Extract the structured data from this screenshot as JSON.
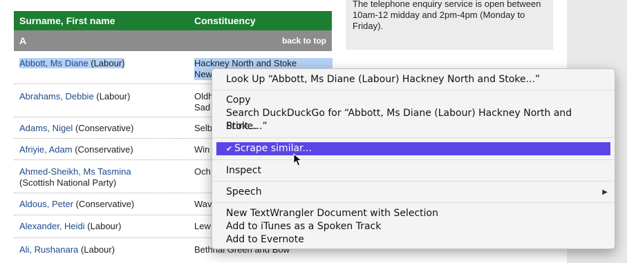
{
  "aside": {
    "enquiry_text": "The telephone enquiry service is open between 10am-12 midday and 2pm-4pm (Monday to Friday)."
  },
  "table": {
    "header": {
      "col_name": "Surname, First name",
      "col_constituency": "Constituency"
    },
    "section_letter": "A",
    "back_to_top": "back to top",
    "rows": [
      {
        "name": "Abbott, Ms Diane",
        "party": "(Labour)",
        "constituency": "Hackney North and Stoke\nNew"
      },
      {
        "name": "Abrahams, Debbie",
        "party": "(Labour)",
        "constituency": "Oldh\nSad"
      },
      {
        "name": "Adams, Nigel",
        "party": "(Conservative)",
        "constituency": "Selb"
      },
      {
        "name": "Afriyie, Adam",
        "party": "(Conservative)",
        "constituency": "Win"
      },
      {
        "name": "Ahmed-Sheikh, Ms Tasmina",
        "party": "(Scottish National Party)",
        "constituency": "Och"
      },
      {
        "name": "Aldous, Peter",
        "party": "(Conservative)",
        "constituency": "Wav"
      },
      {
        "name": "Alexander, Heidi",
        "party": "(Labour)",
        "constituency": "Lew"
      },
      {
        "name": "Ali, Rushanara",
        "party": "(Labour)",
        "constituency": "Bethnal Green and Bow"
      }
    ]
  },
  "context_menu": {
    "look_up": "Look Up “Abbott, Ms Diane (Labour) Hackney North and Stoke...”",
    "copy": "Copy",
    "search": "Search DuckDuckGo for “Abbott, Ms Diane (Labour) Hackney North and Stoke...”",
    "print": "Print...",
    "scrape": "Scrape similar...",
    "inspect": "Inspect",
    "speech": "Speech",
    "new_doc": "New TextWrangler Document with Selection",
    "itunes": "Add to iTunes as a Spoken Track",
    "evernote": "Add to Evernote",
    "highlight_color": "#5a46e6"
  }
}
